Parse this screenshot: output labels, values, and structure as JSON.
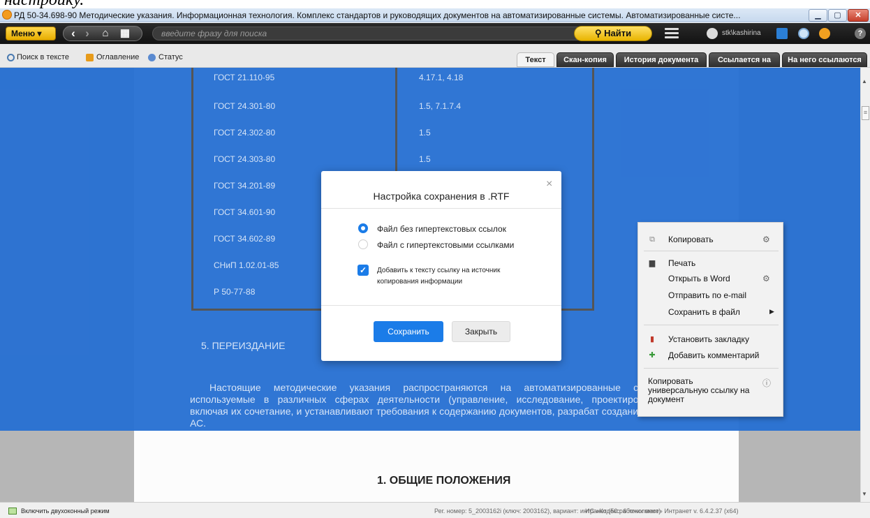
{
  "top_cropped_text": "настройку.",
  "window": {
    "title": "РД 50-34.698-90 Методические указания. Информационная технология. Комплекс стандартов и руководящих документов на автоматизированные системы. Автоматизированные систе..."
  },
  "toolbar": {
    "menu_label": "Меню",
    "search_placeholder": "введите фразу для поиска",
    "find_label": "Найти",
    "user_name": "stk\\kashirina"
  },
  "subbar": {
    "search_in_text": "Поиск в тексте",
    "toc": "Оглавление",
    "status": "Статус",
    "tabs": [
      "Текст",
      "Скан-копия",
      "История документа",
      "Ссылается на",
      "На него ссылаются"
    ],
    "active_tab": "Текст"
  },
  "document": {
    "table_rows": [
      {
        "std": "ГОСТ 21.110-95",
        "ref": "4.17.1, 4.18"
      },
      {
        "std": "ГОСТ 24.301-80",
        "ref": "1.5, 7.1.7.4"
      },
      {
        "std": "ГОСТ 24.302-80",
        "ref": "1.5"
      },
      {
        "std": "ГОСТ 24.303-80",
        "ref": "1.5"
      },
      {
        "std": "ГОСТ 34.201-89",
        "ref": ""
      },
      {
        "std": "ГОСТ 34.601-90",
        "ref": ""
      },
      {
        "std": "ГОСТ 34.602-89",
        "ref": ""
      },
      {
        "std": "СНиП 1.02.01-85",
        "ref": ""
      },
      {
        "std": "Р 50-77-88",
        "ref": ""
      }
    ],
    "section5": "5. ПЕРЕИЗДАНИЕ",
    "paragraph": "Настоящие методические указания распространяются на автоматизированные си используемые в различных сферах деятельности (управление, исследование, проектиров включая их сочетание, и устанавливают требования к содержанию документов, разрабат создании АС.",
    "section1": "1. ОБЩИЕ ПОЛОЖЕНИЯ"
  },
  "dialog": {
    "title": "Настройка сохранения в .RTF",
    "option1": "Файл без гипертекстовых ссылок",
    "option2": "Файл с гипертекстовыми ссылками",
    "option_selected": 1,
    "checkbox_label": "Добавить к тексту ссылку на источник копирования информации",
    "checkbox_checked": true,
    "save": "Сохранить",
    "close": "Закрыть"
  },
  "context_menu": {
    "copy": "Копировать",
    "print": "Печать",
    "open_word": "Открыть в Word",
    "send_email": "Отправить по e-mail",
    "save_file": "Сохранить в файл",
    "bookmark": "Установить закладку",
    "comment": "Добавить комментарий",
    "copy_link": "Копировать универсальную ссылку на документ"
  },
  "statusbar": {
    "dual_window": "Включить двухоконный режим",
    "reg_info": "Рег. номер: 5_2003162i (ключ: 2003162), вариант: интранет (50 рабочих мест)",
    "version": "ИС «Кодекс: 6 поколение» Интранет v. 6.4.2.37 (x64)"
  },
  "colors": {
    "accent": "#1b7ce8",
    "overlay": "#2870d2",
    "find_button": "#f0c20e"
  }
}
